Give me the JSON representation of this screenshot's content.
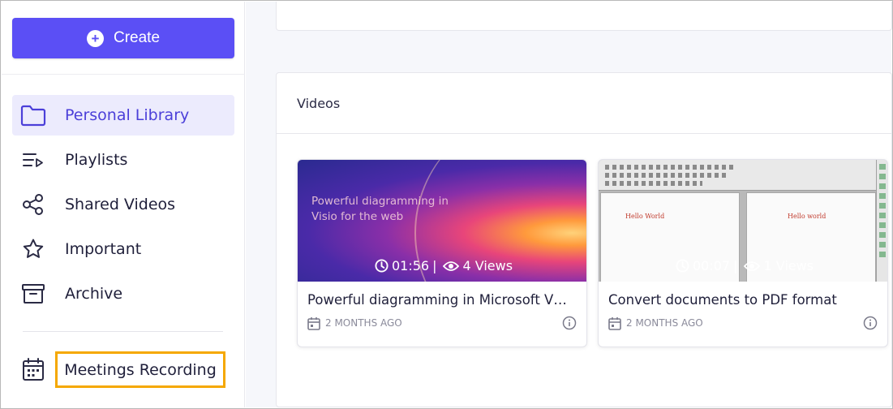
{
  "sidebar": {
    "create_label": "Create",
    "items": [
      {
        "label": "Personal Library",
        "icon": "folder-icon",
        "active": true
      },
      {
        "label": "Playlists",
        "icon": "playlist-icon",
        "active": false
      },
      {
        "label": "Shared Videos",
        "icon": "share-icon",
        "active": false
      },
      {
        "label": "Important",
        "icon": "star-icon",
        "active": false
      },
      {
        "label": "Archive",
        "icon": "archive-icon",
        "active": false
      }
    ],
    "meetings_label": "Meetings Recording"
  },
  "main": {
    "videos_title": "Videos",
    "videos": [
      {
        "title": "Powerful diagramming in Microsoft V…",
        "duration": "01:56",
        "views": "4 Views",
        "date": "2 MONTHS AGO",
        "thumbnail_text": "Powerful diagramming in Visio for the web"
      },
      {
        "title": "Convert documents to PDF format",
        "duration": "00:07",
        "views": "1 Views",
        "date": "2 MONTHS AGO",
        "thumbnail_text_left": "Hello World",
        "thumbnail_text_right": "Hello world"
      }
    ]
  },
  "colors": {
    "accent": "#5b4ff5",
    "active_bg": "#ecebfd",
    "highlight": "#f5a800"
  }
}
